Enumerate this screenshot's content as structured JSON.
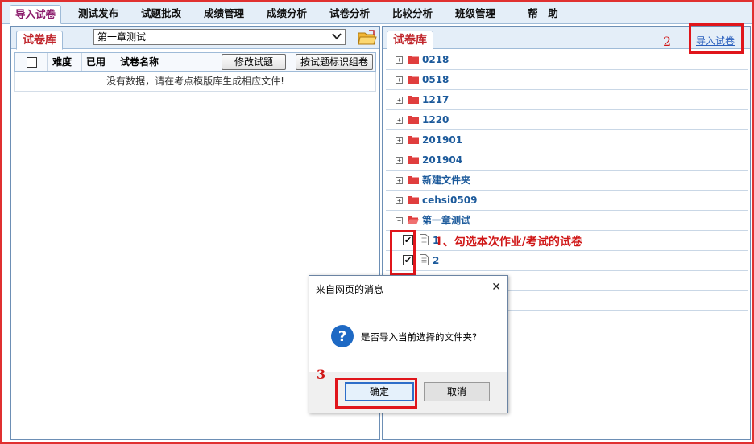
{
  "tabs": [
    {
      "label": "导入试卷",
      "active": true
    },
    {
      "label": "测试发布"
    },
    {
      "label": "试题批改"
    },
    {
      "label": "成绩管理"
    },
    {
      "label": "成绩分析"
    },
    {
      "label": "试卷分析"
    },
    {
      "label": "比较分析"
    },
    {
      "label": "班级管理"
    },
    {
      "label": "帮　助"
    }
  ],
  "left_panel": {
    "tab_label": "试卷库",
    "chapter_select": {
      "value": "第一章测试"
    },
    "columns": [
      "难度",
      "已用",
      "试卷名称"
    ],
    "edit_button": "修改试题",
    "compose_button": "按试题标识组卷",
    "empty_message": "没有数据，请在考点模版库生成相应文件!"
  },
  "right_panel": {
    "tab_label": "试卷库",
    "import_link": "导入试卷",
    "folders": [
      {
        "name": "0218"
      },
      {
        "name": "0518"
      },
      {
        "name": "1217"
      },
      {
        "name": "1220"
      },
      {
        "name": "201901"
      },
      {
        "name": "201904"
      },
      {
        "name": "新建文件夹"
      },
      {
        "name": "cehsi0509"
      },
      {
        "name": "第一章测试",
        "expanded": true
      }
    ],
    "files": [
      {
        "name": "1",
        "checked": true
      },
      {
        "name": "2",
        "checked": true
      }
    ]
  },
  "annotations": {
    "step1": "1、勾选本次作业/考试的试卷",
    "step2": "2",
    "step3": "3"
  },
  "dialog": {
    "title": "来自网页的消息",
    "message": "是否导入当前选择的文件夹?",
    "ok_label": "确定",
    "cancel_label": "取消",
    "close_glyph": "✕"
  },
  "colors": {
    "accent_red": "#e0151b",
    "tab_active_text": "#8b1a6b",
    "tree_text": "#1c5a9b"
  }
}
